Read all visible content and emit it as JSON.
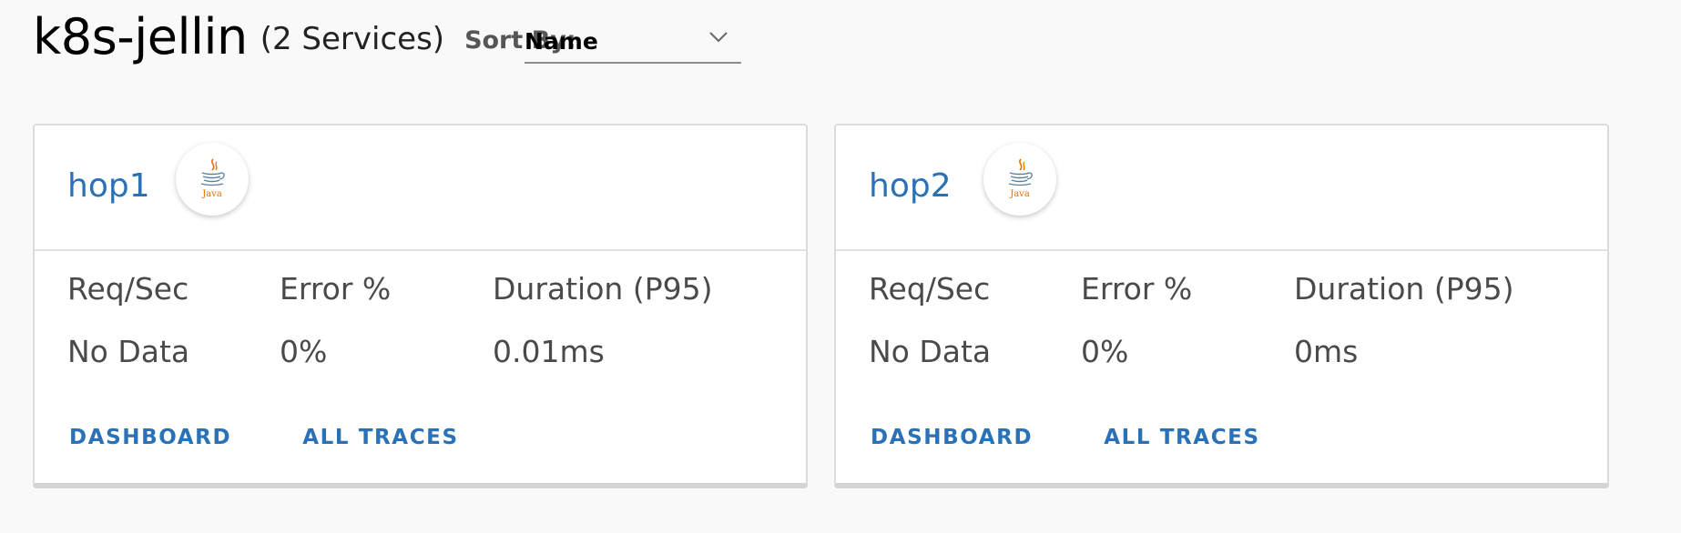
{
  "header": {
    "title": "k8s-jellin",
    "count_text": "(2 Services)",
    "sort_label": "Sort By:",
    "sort_value": "Name"
  },
  "cards": [
    {
      "name": "hop1",
      "language_icon": "java-icon",
      "labels": {
        "req": "Req/Sec",
        "error": "Error %",
        "duration": "Duration (P95)"
      },
      "values": {
        "req": "No Data",
        "error": "0%",
        "duration": "0.01ms"
      },
      "actions": {
        "dashboard": "DASHBOARD",
        "traces": "ALL TRACES"
      }
    },
    {
      "name": "hop2",
      "language_icon": "java-icon",
      "labels": {
        "req": "Req/Sec",
        "error": "Error %",
        "duration": "Duration (P95)"
      },
      "values": {
        "req": "No Data",
        "error": "0%",
        "duration": "0ms"
      },
      "actions": {
        "dashboard": "DASHBOARD",
        "traces": "ALL TRACES"
      }
    }
  ],
  "java_logo_text": "Java",
  "colors": {
    "link": "#2a72b5",
    "java_orange": "#e76f00",
    "java_blue": "#5382a1"
  }
}
